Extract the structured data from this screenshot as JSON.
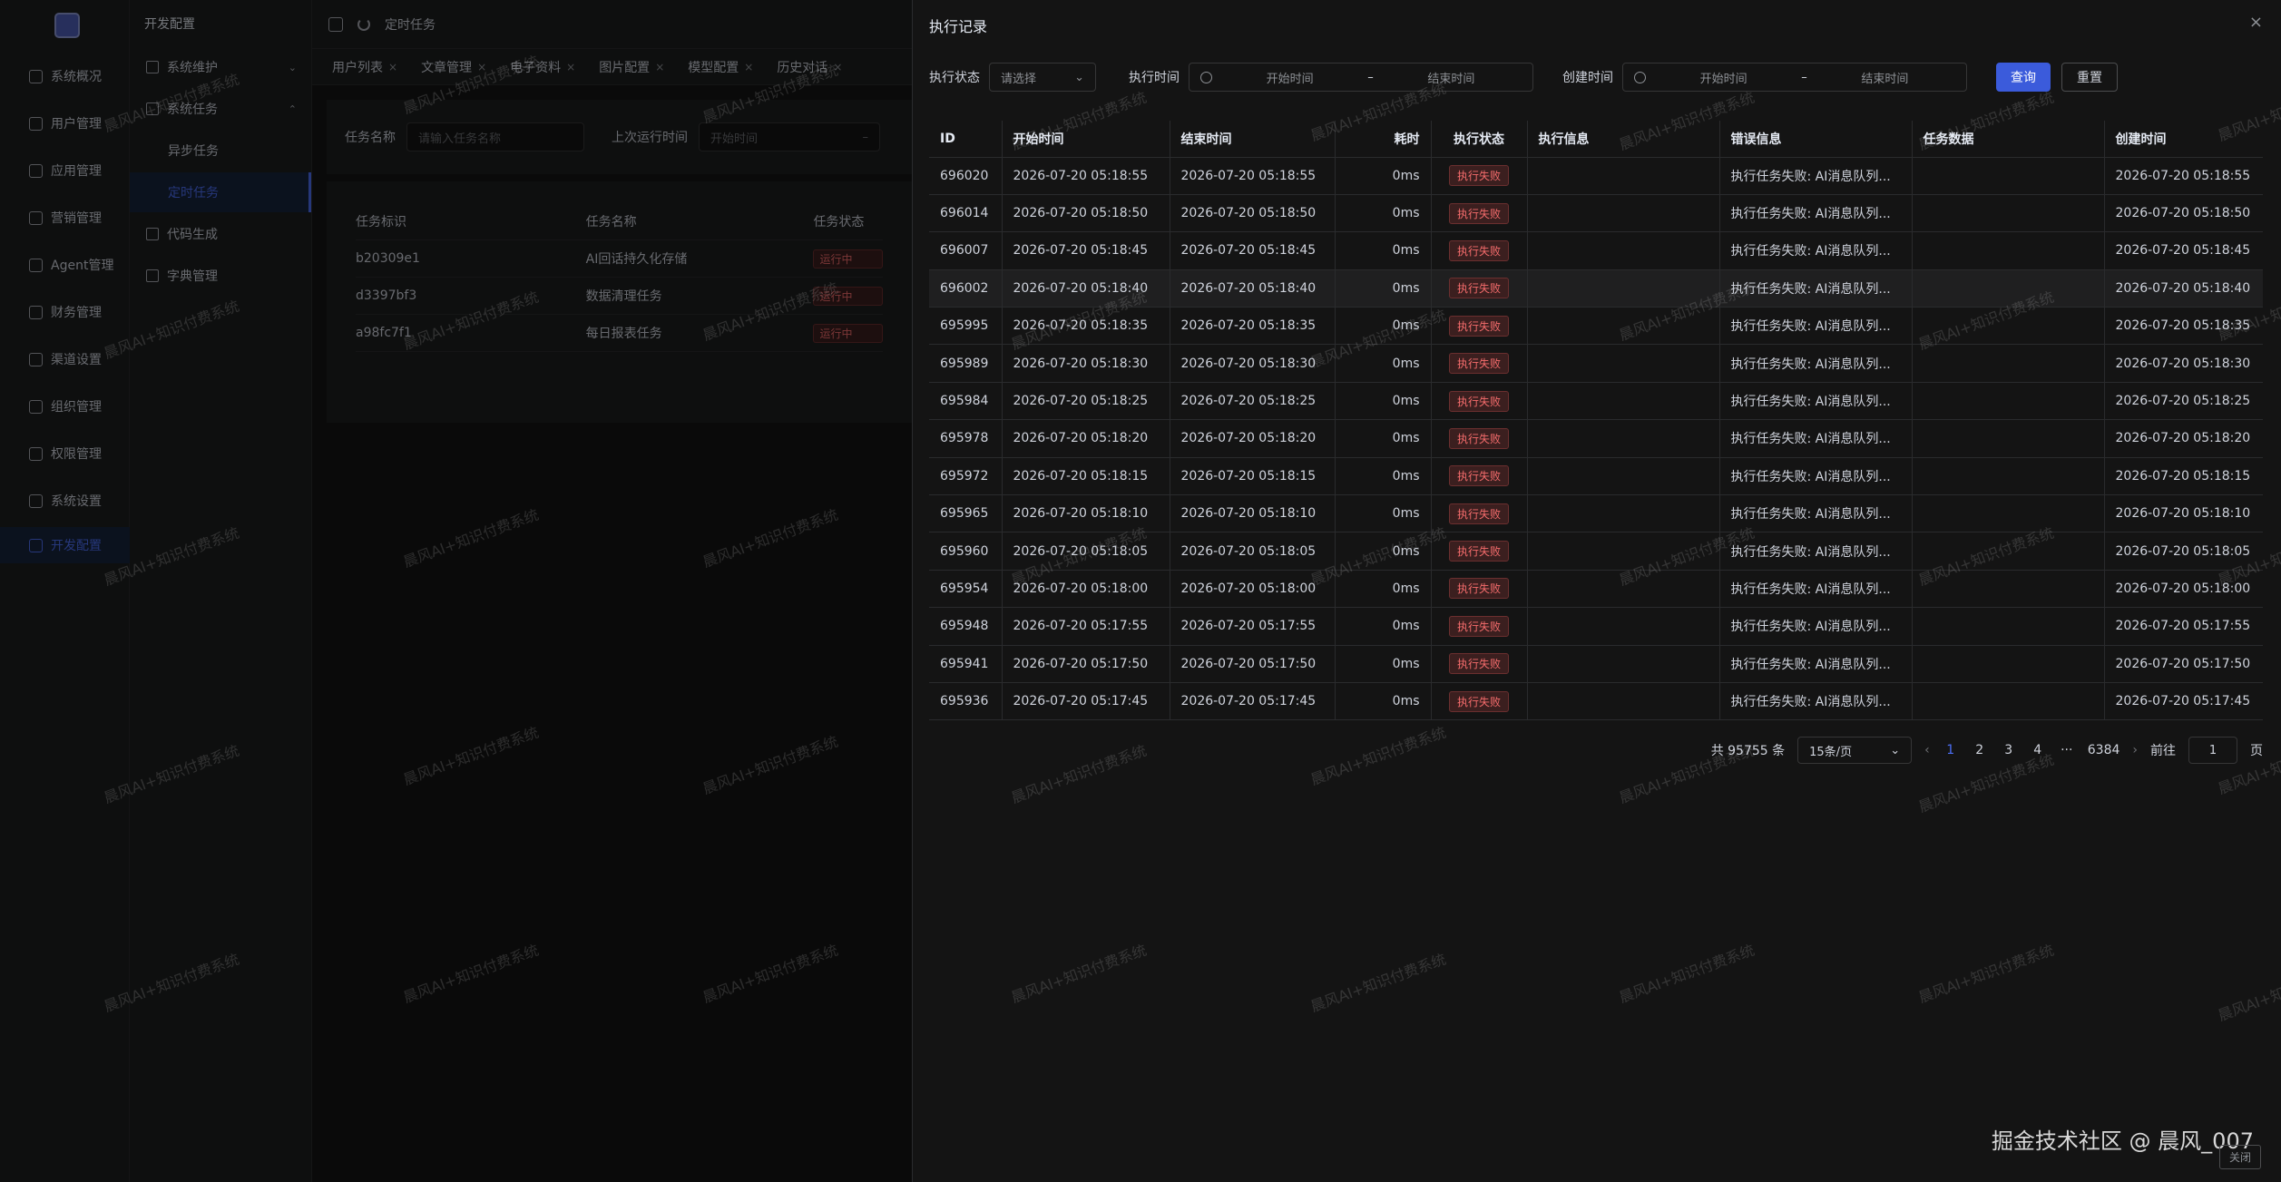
{
  "rail": {
    "items": [
      {
        "label": "系统概况",
        "icon": "monitor-icon"
      },
      {
        "label": "用户管理",
        "icon": "user-icon"
      },
      {
        "label": "应用管理",
        "icon": "app-icon"
      },
      {
        "label": "营销管理",
        "icon": "marketing-icon"
      },
      {
        "label": "Agent管理",
        "icon": "agent-icon"
      },
      {
        "label": "财务管理",
        "icon": "chart-icon"
      },
      {
        "label": "渠道设置",
        "icon": "mail-icon"
      },
      {
        "label": "组织管理",
        "icon": "org-icon"
      },
      {
        "label": "权限管理",
        "icon": "lock-icon"
      },
      {
        "label": "系统设置",
        "icon": "gear-icon"
      },
      {
        "label": "开发配置",
        "icon": "dev-icon"
      }
    ]
  },
  "menu": {
    "title": "开发配置",
    "items": [
      {
        "label": "系统维护"
      },
      {
        "label": "系统任务"
      },
      {
        "label": "异步任务"
      },
      {
        "label": "定时任务"
      },
      {
        "label": "代码生成"
      },
      {
        "label": "字典管理"
      }
    ]
  },
  "topbar": {
    "breadcrumb": "定时任务"
  },
  "tabs": [
    "用户列表",
    "文章管理",
    "电子资料",
    "图片配置",
    "模型配置",
    "历史对话"
  ],
  "task_search": {
    "name_label": "任务名称",
    "name_placeholder": "请输入任务名称",
    "last_run_label": "上次运行时间",
    "start_placeholder": "开始时间",
    "range_sep": "–"
  },
  "task_table": {
    "headers": [
      "任务标识",
      "任务名称",
      "任务状态"
    ],
    "rows": [
      {
        "id": "b20309e1",
        "name": "AI回话持久化存储",
        "status": "运行中"
      },
      {
        "id": "d3397bf3",
        "name": "数据清理任务",
        "status": "运行中"
      },
      {
        "id": "a98fc7f1",
        "name": "每日报表任务",
        "status": "运行中"
      }
    ]
  },
  "drawer": {
    "title": "执行记录",
    "close": "×",
    "filters": {
      "status_label": "执行状态",
      "status_placeholder": "请选择",
      "exec_time_label": "执行时间",
      "create_time_label": "创建时间",
      "start_placeholder": "开始时间",
      "end_placeholder": "结束时间",
      "range_sep": "–",
      "query": "查询",
      "reset": "重置"
    },
    "table": {
      "headers": [
        "ID",
        "开始时间",
        "结束时间",
        "耗时",
        "执行状态",
        "执行信息",
        "错误信息",
        "任务数据",
        "创建时间"
      ],
      "rows": [
        {
          "id": "696020",
          "start": "2026-07-20 05:18:55",
          "end": "2026-07-20 05:18:55",
          "cost": "0ms",
          "status": "执行失败",
          "info": "",
          "error": "执行任务失败: AI消息队列...",
          "data": "",
          "created": "2026-07-20 05:18:55"
        },
        {
          "id": "696014",
          "start": "2026-07-20 05:18:50",
          "end": "2026-07-20 05:18:50",
          "cost": "0ms",
          "status": "执行失败",
          "info": "",
          "error": "执行任务失败: AI消息队列...",
          "data": "",
          "created": "2026-07-20 05:18:50"
        },
        {
          "id": "696007",
          "start": "2026-07-20 05:18:45",
          "end": "2026-07-20 05:18:45",
          "cost": "0ms",
          "status": "执行失败",
          "info": "",
          "error": "执行任务失败: AI消息队列...",
          "data": "",
          "created": "2026-07-20 05:18:45"
        },
        {
          "id": "696002",
          "start": "2026-07-20 05:18:40",
          "end": "2026-07-20 05:18:40",
          "cost": "0ms",
          "status": "执行失败",
          "info": "",
          "error": "执行任务失败: AI消息队列...",
          "data": "",
          "created": "2026-07-20 05:18:40"
        },
        {
          "id": "695995",
          "start": "2026-07-20 05:18:35",
          "end": "2026-07-20 05:18:35",
          "cost": "0ms",
          "status": "执行失败",
          "info": "",
          "error": "执行任务失败: AI消息队列...",
          "data": "",
          "created": "2026-07-20 05:18:35"
        },
        {
          "id": "695989",
          "start": "2026-07-20 05:18:30",
          "end": "2026-07-20 05:18:30",
          "cost": "0ms",
          "status": "执行失败",
          "info": "",
          "error": "执行任务失败: AI消息队列...",
          "data": "",
          "created": "2026-07-20 05:18:30"
        },
        {
          "id": "695984",
          "start": "2026-07-20 05:18:25",
          "end": "2026-07-20 05:18:25",
          "cost": "0ms",
          "status": "执行失败",
          "info": "",
          "error": "执行任务失败: AI消息队列...",
          "data": "",
          "created": "2026-07-20 05:18:25"
        },
        {
          "id": "695978",
          "start": "2026-07-20 05:18:20",
          "end": "2026-07-20 05:18:20",
          "cost": "0ms",
          "status": "执行失败",
          "info": "",
          "error": "执行任务失败: AI消息队列...",
          "data": "",
          "created": "2026-07-20 05:18:20"
        },
        {
          "id": "695972",
          "start": "2026-07-20 05:18:15",
          "end": "2026-07-20 05:18:15",
          "cost": "0ms",
          "status": "执行失败",
          "info": "",
          "error": "执行任务失败: AI消息队列...",
          "data": "",
          "created": "2026-07-20 05:18:15"
        },
        {
          "id": "695965",
          "start": "2026-07-20 05:18:10",
          "end": "2026-07-20 05:18:10",
          "cost": "0ms",
          "status": "执行失败",
          "info": "",
          "error": "执行任务失败: AI消息队列...",
          "data": "",
          "created": "2026-07-20 05:18:10"
        },
        {
          "id": "695960",
          "start": "2026-07-20 05:18:05",
          "end": "2026-07-20 05:18:05",
          "cost": "0ms",
          "status": "执行失败",
          "info": "",
          "error": "执行任务失败: AI消息队列...",
          "data": "",
          "created": "2026-07-20 05:18:05"
        },
        {
          "id": "695954",
          "start": "2026-07-20 05:18:00",
          "end": "2026-07-20 05:18:00",
          "cost": "0ms",
          "status": "执行失败",
          "info": "",
          "error": "执行任务失败: AI消息队列...",
          "data": "",
          "created": "2026-07-20 05:18:00"
        },
        {
          "id": "695948",
          "start": "2026-07-20 05:17:55",
          "end": "2026-07-20 05:17:55",
          "cost": "0ms",
          "status": "执行失败",
          "info": "",
          "error": "执行任务失败: AI消息队列...",
          "data": "",
          "created": "2026-07-20 05:17:55"
        },
        {
          "id": "695941",
          "start": "2026-07-20 05:17:50",
          "end": "2026-07-20 05:17:50",
          "cost": "0ms",
          "status": "执行失败",
          "info": "",
          "error": "执行任务失败: AI消息队列...",
          "data": "",
          "created": "2026-07-20 05:17:50"
        },
        {
          "id": "695936",
          "start": "2026-07-20 05:17:45",
          "end": "2026-07-20 05:17:45",
          "cost": "0ms",
          "status": "执行失败",
          "info": "",
          "error": "执行任务失败: AI消息队列...",
          "data": "",
          "created": "2026-07-20 05:17:45"
        }
      ]
    },
    "pagination": {
      "total": "共 95755 条",
      "page_size": "15条/页",
      "pages": [
        "1",
        "2",
        "3",
        "4"
      ],
      "ellipsis": "···",
      "last_page": "6384",
      "goto_label": "前往",
      "goto_value": "1",
      "page_unit": "页",
      "prev": "‹",
      "next": "›"
    }
  },
  "watermark_text": "晨风AI+知识付费系统",
  "footer": {
    "credit": "掘金技术社区 @ 晨风_007",
    "close_hint": "关闭"
  },
  "colors": {
    "accent": "#3b5bdb",
    "danger": "#f56c6c",
    "background": "#141414"
  }
}
